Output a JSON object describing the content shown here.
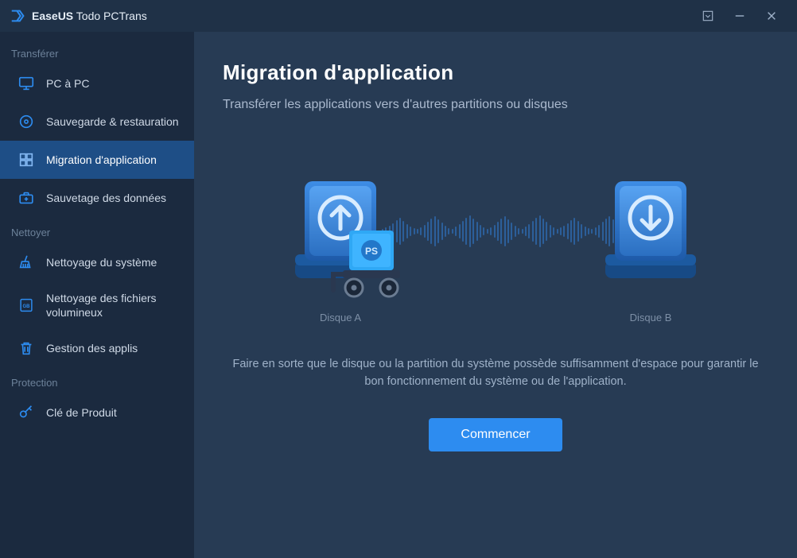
{
  "titlebar": {
    "brand_strong": "EaseUS",
    "brand_rest": " Todo PCTrans"
  },
  "sidebar": {
    "sections": {
      "transfer": {
        "title": "Transférer"
      },
      "clean": {
        "title": "Nettoyer"
      },
      "protect": {
        "title": "Protection"
      }
    },
    "items": {
      "pc_to_pc": {
        "label": "PC à PC"
      },
      "backup_restore": {
        "label": "Sauvegarde & restauration"
      },
      "app_migration": {
        "label": "Migration d'application"
      },
      "data_rescue": {
        "label": "Sauvetage des données"
      },
      "sys_cleanup": {
        "label": "Nettoyage du système"
      },
      "large_files": {
        "label": "Nettoyage des fichiers volumineux"
      },
      "app_mgmt": {
        "label": "Gestion des applis"
      },
      "product_key": {
        "label": "Clé de Produit"
      }
    }
  },
  "main": {
    "title": "Migration d'application",
    "subtitle": "Transférer les applications vers d'autres partitions ou disques",
    "disk_a_label": "Disque A",
    "disk_b_label": "Disque B",
    "hint": "Faire en sorte que le disque ou la partition du système possède suffisamment d'espace pour garantir le bon fonctionnement du système ou de l'application.",
    "cta_label": "Commencer",
    "cart_box_text": "PS"
  }
}
